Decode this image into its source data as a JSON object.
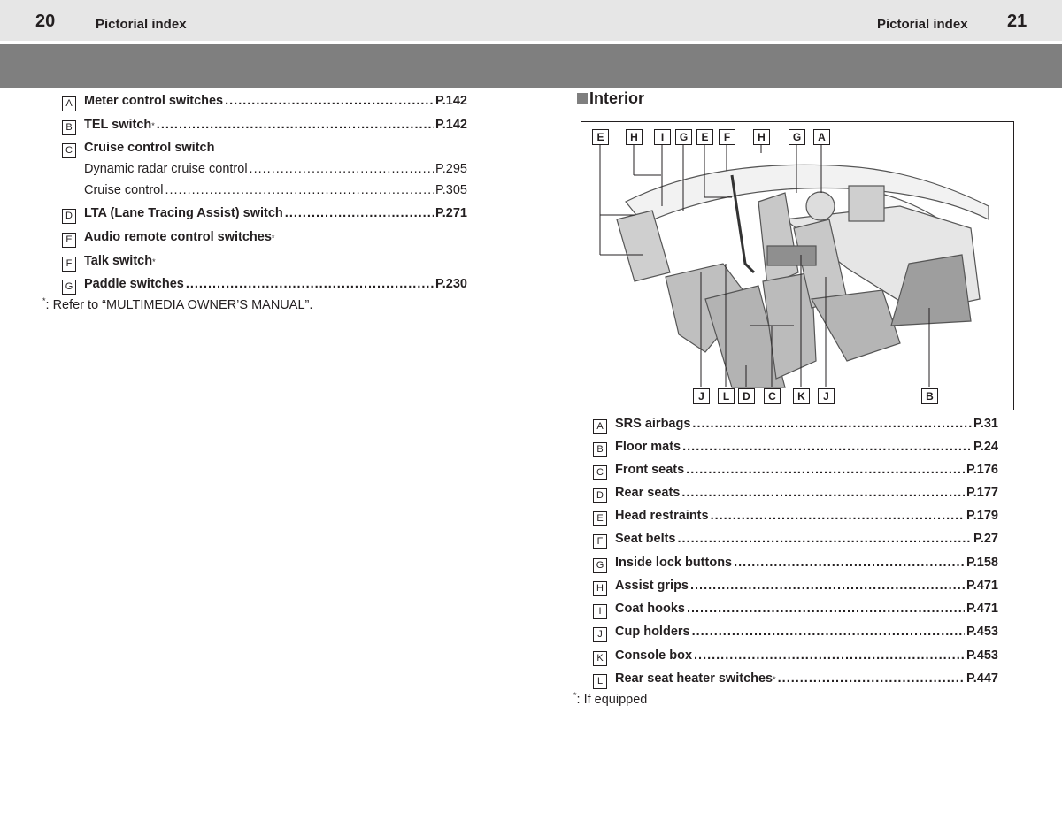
{
  "header": {
    "left_page_number": "20",
    "left_title": "Pictorial index",
    "right_title": "Pictorial index",
    "right_page_number": "21"
  },
  "left_list": [
    {
      "letter": "A",
      "label": "Meter control switches",
      "dots": "....................................................",
      "page": "P.142"
    },
    {
      "letter": "B",
      "label": "TEL switch",
      "dots": "........................................................................",
      "page": "P.142",
      "sup": "*"
    },
    {
      "letter": "C",
      "label": "Cruise control switch"
    },
    {
      "label": "Dynamic radar cruise control",
      "dots": "................................................",
      "page": "P.295"
    },
    {
      "label": "Cruise control",
      "dots": "...........................................................................",
      "page": "P.305"
    },
    {
      "letter": "D",
      "label": "LTA (Lane Tracing Assist) switch",
      "dots": "......................................",
      "page": "P.271"
    },
    {
      "letter": "E",
      "label": "Audio remote control switches",
      "sup": "*"
    },
    {
      "letter": "F",
      "label": "Talk switch",
      "sup": "*"
    },
    {
      "letter": "G",
      "label": "Paddle switches",
      "dots": ".................................................................",
      "page": "P.230"
    }
  ],
  "left_footnote": {
    "mark": "*",
    "text": ": Refer to “MULTIMEDIA OWNER’S MANUAL”."
  },
  "interior": {
    "title": "Interior",
    "top_callouts": [
      "E",
      "H",
      "I",
      "G",
      "E",
      "F",
      "H",
      "G",
      "A"
    ],
    "bottom_callouts": [
      "J",
      "L",
      "D",
      "C",
      "K",
      "J",
      "B"
    ]
  },
  "right_list": [
    {
      "letter": "A",
      "label": "SRS airbags",
      "dots": "..........................................................................",
      "page": "P.31"
    },
    {
      "letter": "B",
      "label": "Floor mats",
      "dots": "..............................................................................",
      "page": "P.24"
    },
    {
      "letter": "C",
      "label": "Front seats",
      "dots": "........................................................................",
      "page": "P.176"
    },
    {
      "letter": "D",
      "label": "Rear seats",
      "dots": "..........................................................................",
      "page": "P.177"
    },
    {
      "letter": "E",
      "label": "Head restraints",
      "dots": "..................................................................",
      "page": "P.179"
    },
    {
      "letter": "F",
      "label": "Seat belts",
      "dots": "..............................................................................",
      "page": "P.27"
    },
    {
      "letter": "G",
      "label": "Inside lock buttons",
      "dots": "............................................................",
      "page": "P.158"
    },
    {
      "letter": "H",
      "label": "Assist grips",
      "dots": "........................................................................",
      "page": "P.471"
    },
    {
      "letter": "I",
      "label": "Coat hooks",
      "dots": ".........................................................................",
      "page": "P.471"
    },
    {
      "letter": "J",
      "label": "Cup holders",
      "dots": "........................................................................",
      "page": "P.453"
    },
    {
      "letter": "K",
      "label": "Console box",
      "dots": ".......................................................................",
      "page": "P.453"
    },
    {
      "letter": "L",
      "label": "Rear seat heater switches",
      "dots": "................................................",
      "page": "P.447",
      "sup": "*"
    }
  ],
  "right_footnote": {
    "mark": "*",
    "text": ": If equipped"
  }
}
